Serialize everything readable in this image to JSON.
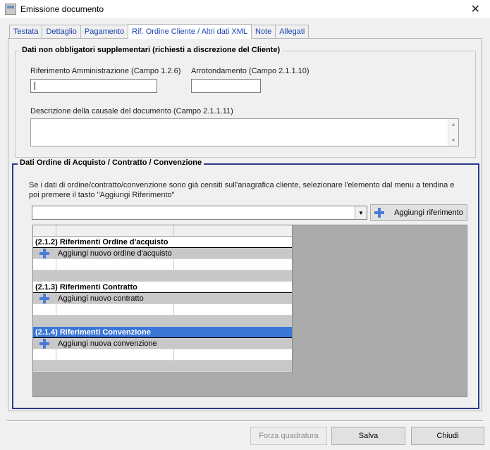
{
  "window": {
    "title": "Emissione documento"
  },
  "tabs": [
    {
      "label": "Testata"
    },
    {
      "label": "Dettaglio"
    },
    {
      "label": "Pagamento"
    },
    {
      "label": "Rif. Ordine Cliente / Altri dati XML",
      "active": true
    },
    {
      "label": "Note"
    },
    {
      "label": "Allegati"
    }
  ],
  "group_extra": {
    "title": "Dati non obbligatori supplementari (richiesti a discrezione del Cliente)",
    "rif_amm_label": "Riferimento Amministrazione (Campo 1.2.6)",
    "rif_amm_value": "",
    "arrot_label": "Arrotondamento (Campo 2.1.1.10)",
    "arrot_value": "",
    "causale_label": "Descrizione della causale del documento (Campo 2.1.1.11)",
    "causale_value": ""
  },
  "group_ordini": {
    "title": "Dati Ordine di Acquisto / Contratto / Convenzione",
    "info": "Se i dati di ordine/contratto/convenzione sono già censiti sull'anagrafica cliente, selezionare l'elemento dal menu a tendina e poi premere il tasto \"Aggiungi Riferimento\"",
    "combo_value": "",
    "add_button": "Aggiungi riferimento",
    "sections": [
      {
        "title": "(2.1.2) Riferimenti Ordine d'acquisto",
        "add_label": "Aggiungi nuovo ordine d'acquisto",
        "selected": false
      },
      {
        "title": "(2.1.3) Riferimenti Contratto",
        "add_label": "Aggiungi nuovo contratto",
        "selected": false
      },
      {
        "title": "(2.1.4) Riferimenti Convenzione",
        "add_label": "Aggiungi nuova convenzione",
        "selected": true
      }
    ]
  },
  "footer": {
    "forza": "Forza quadratura",
    "salva": "Salva",
    "chiudi": "Chiudi"
  },
  "colors": {
    "tab_text": "#1a3fb0",
    "group_border": "#2b3c8a",
    "selection": "#3b77d7",
    "plus_icon": "#4a7bdc"
  }
}
